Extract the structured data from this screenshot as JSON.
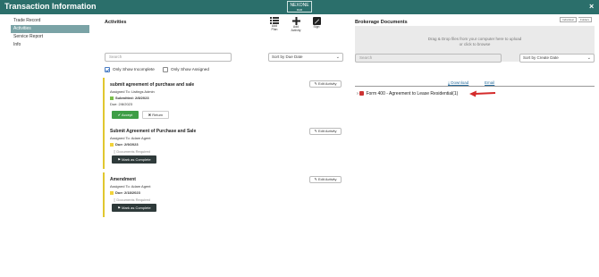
{
  "window": {
    "title": "Transaction Information",
    "logo_text": "NEXONE",
    "logo_sub": "RAR",
    "close_glyph": "×"
  },
  "sidebar": {
    "items": [
      {
        "label": "Trade Record",
        "active": false
      },
      {
        "label": "Activities",
        "active": true
      },
      {
        "label": "Service Report",
        "active": false
      },
      {
        "label": "Info",
        "active": false
      }
    ]
  },
  "activities": {
    "heading": "Activities",
    "tools": [
      {
        "label_1": "Add",
        "label_2": "Plan",
        "icon": "list-icon"
      },
      {
        "label_1": "Add",
        "label_2": "Activity",
        "icon": "plus-icon"
      },
      {
        "label_1": "Sign",
        "label_2": "",
        "icon": "pen-icon"
      }
    ],
    "search_placeholder": "Search",
    "sort_value": "Sort by Due Date",
    "filter_incomplete": "Only Show Incomplete",
    "filter_assigned": "Only Show Assigned",
    "edit_label": "Edit Activity",
    "cards": [
      {
        "title": "submit agreement of purchase and sale",
        "assigned": "Assigned To:  Listings Admin",
        "status": "Submitted: 2/8/2023",
        "due": "Due: 2/8/2023",
        "accept_label": "Accept",
        "return_label": "Return"
      },
      {
        "title": "Submit Agreement of Purchase and Sale",
        "assigned": "Assigned To:  Adam Agent",
        "due": "Due: 2/9/2023",
        "docs": "Documents Required",
        "complete_label": "Mark as Complete"
      },
      {
        "title": "Amendment",
        "assigned": "Assigned To:  Adam Agent",
        "due": "Due: 2/18/2023",
        "docs": "Documents Required",
        "complete_label": "Mark as Complete"
      }
    ]
  },
  "brokerage": {
    "heading": "Brokerage Documents",
    "toggle_1": "Individual",
    "toggle_2": "Folders",
    "drop_line_1": "Drag & Drop files from your computer here to upload",
    "drop_line_2": "or click to browse",
    "search_placeholder": "Search",
    "sort_value": "Sort by Create Date",
    "download_label": "Download",
    "email_label": "Email",
    "form_label": "Form 400 - Agreement to Lease Residential(1)"
  },
  "colors": {
    "accent": "#2b6f6b",
    "sidebar_active": "#7aa3a6",
    "card_border": "#e1c72f",
    "accept": "#3e9e46",
    "arrow": "#d42a2a"
  }
}
